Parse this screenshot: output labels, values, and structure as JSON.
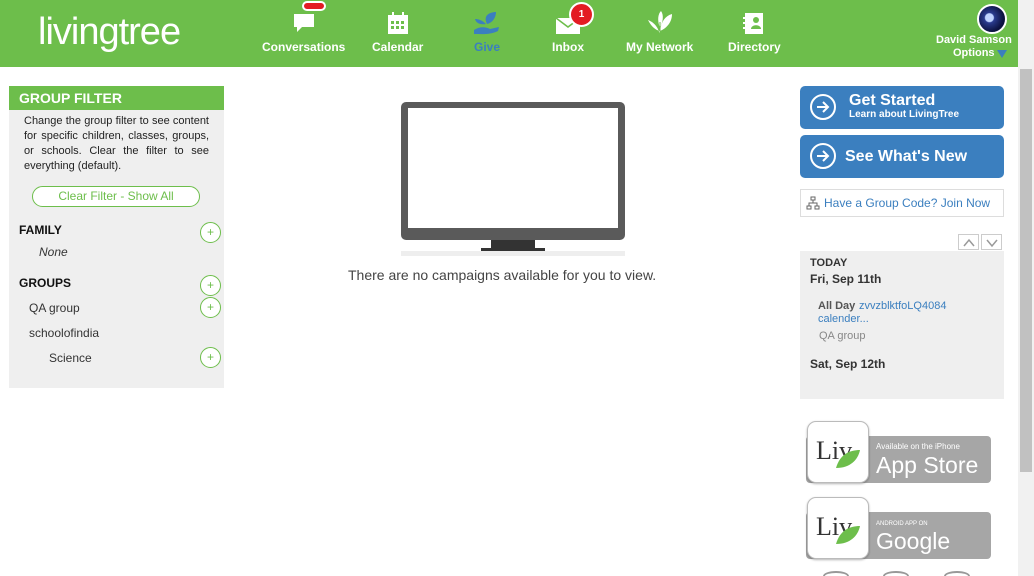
{
  "brand": {
    "logo_text": "livingtree",
    "primary_color": "#6dbe4b",
    "accent_color": "#3b7fbf"
  },
  "nav": {
    "items": [
      {
        "label": "Conversations",
        "icon": "chat-bubble-icon"
      },
      {
        "label": "Calendar",
        "icon": "calendar-icon"
      },
      {
        "label": "Give",
        "icon": "giving-hand-icon"
      },
      {
        "label": "Inbox",
        "icon": "envelope-icon",
        "badge": "1"
      },
      {
        "label": "My Network",
        "icon": "leaf-network-icon"
      },
      {
        "label": "Directory",
        "icon": "contact-card-icon"
      }
    ]
  },
  "user": {
    "name": "David Samson",
    "options_label": "Options"
  },
  "group_filter": {
    "title": "GROUP FILTER",
    "description": "Change the group filter to see content for specific children, classes, groups, or schools. Clear the filter to see everything (default).",
    "clear_label": "Clear Filter - Show All",
    "family_label": "FAMILY",
    "family_none": "None",
    "groups_label": "GROUPS",
    "groups": [
      "QA group",
      "schoolofindia",
      "Science"
    ],
    "plus": "+"
  },
  "main": {
    "empty_message": "There are no campaigns available for you to view."
  },
  "sidebar": {
    "get_started": {
      "title": "Get Started",
      "subtitle": "Learn about LivingTree"
    },
    "whats_new": {
      "title": "See What's New"
    },
    "group_code": "Have a Group Code? Join Now"
  },
  "calendar": {
    "today_label": "TODAY",
    "date1": "Fri, Sep 11th",
    "event_time": "All Day",
    "event_title_1": "zvvzblktfoLQ4084",
    "event_title_2": "calender...",
    "event_group": "QA group",
    "date2": "Sat, Sep 12th"
  },
  "app_badges": {
    "apple": {
      "small": "Available on the iPhone",
      "big": "App Store",
      "icon_text": "Liv"
    },
    "google": {
      "small": "ANDROID APP ON",
      "big": "Google play",
      "icon_text": "Liv"
    }
  }
}
